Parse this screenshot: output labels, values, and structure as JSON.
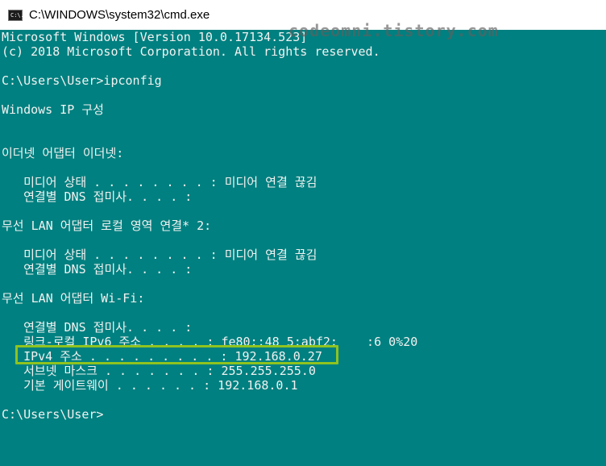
{
  "window": {
    "title": "C:\\WINDOWS\\system32\\cmd.exe",
    "icon_name": "cmd-icon",
    "icon_text": "C:\\."
  },
  "watermark": "codeomni.tistory.com",
  "colors": {
    "console_bg": "#008080",
    "console_text": "#f2f2f2",
    "highlight": "#8fc31f"
  },
  "console": {
    "lines": [
      "Microsoft Windows [Version 10.0.17134.523]",
      "(c) 2018 Microsoft Corporation. All rights reserved.",
      "",
      "C:\\Users\\User>ipconfig",
      "",
      "Windows IP 구성",
      "",
      "",
      "이더넷 어댑터 이더넷:",
      "",
      "   미디어 상태 . . . . . . . . : 미디어 연결 끊김",
      "   연결별 DNS 접미사. . . . :",
      "",
      "무선 LAN 어댑터 로컬 영역 연결* 2:",
      "",
      "   미디어 상태 . . . . . . . . : 미디어 연결 끊김",
      "   연결별 DNS 접미사. . . . :",
      "",
      "무선 LAN 어댑터 Wi-Fi:",
      "",
      "   연결별 DNS 접미사. . . . :",
      "   링크-로컬 IPv6 주소 . . . . : fe80::48 5:abf2:    :6 0%20",
      "   IPv4 주소 . . . . . . . . . : 192.168.0.27",
      "   서브넷 마스크 . . . . . . . : 255.255.255.0",
      "   기본 게이트웨이 . . . . . . : 192.168.0.1",
      "",
      "C:\\Users\\User>"
    ]
  }
}
